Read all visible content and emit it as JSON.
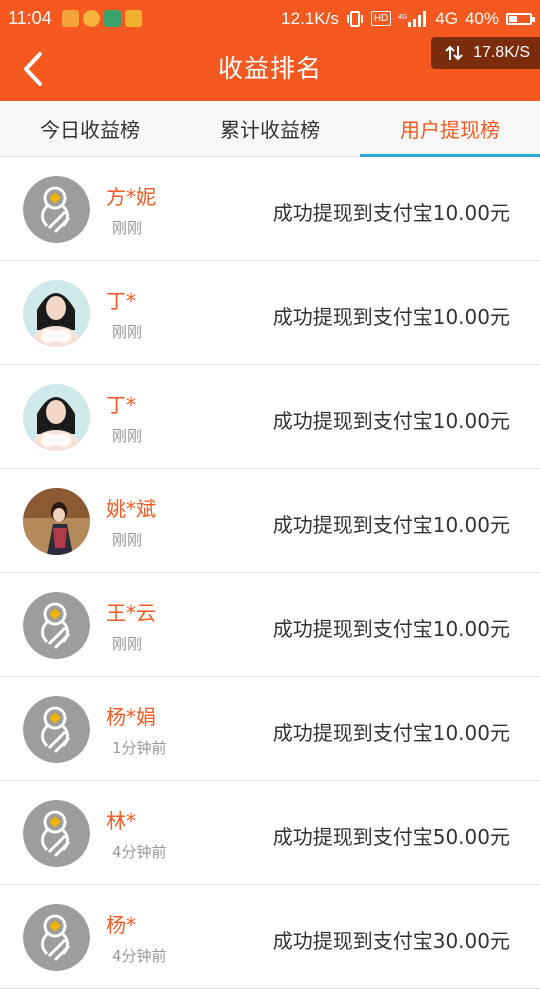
{
  "status_bar": {
    "time": "11:04",
    "net_speed": "12.1K/s",
    "hd": "HD",
    "network": "4G",
    "battery": "40%",
    "battery_level": 0.4
  },
  "header": {
    "title": "收益排名",
    "floating_speed": "17.8K/S"
  },
  "tabs": [
    {
      "label": "今日收益榜",
      "active": false
    },
    {
      "label": "累计收益榜",
      "active": false
    },
    {
      "label": "用户提现榜",
      "active": true
    }
  ],
  "records": [
    {
      "name": "方*妮",
      "time": "刚刚",
      "text": "成功提现到支付宝10.00元",
      "avatar": "default"
    },
    {
      "name": "丁*",
      "time": "刚刚",
      "text": "成功提现到支付宝10.00元",
      "avatar": "photo-girl"
    },
    {
      "name": "丁*",
      "time": "刚刚",
      "text": "成功提现到支付宝10.00元",
      "avatar": "photo-girl"
    },
    {
      "name": "姚*斌",
      "time": "刚刚",
      "text": "成功提现到支付宝10.00元",
      "avatar": "photo-kimono"
    },
    {
      "name": "王*云",
      "time": "刚刚",
      "text": "成功提现到支付宝10.00元",
      "avatar": "default"
    },
    {
      "name": "杨*娟",
      "time": "1分钟前",
      "text": "成功提现到支付宝10.00元",
      "avatar": "default"
    },
    {
      "name": "林*",
      "time": "4分钟前",
      "text": "成功提现到支付宝50.00元",
      "avatar": "default"
    },
    {
      "name": "杨*",
      "time": "4分钟前",
      "text": "成功提现到支付宝30.00元",
      "avatar": "default"
    }
  ],
  "colors": {
    "accent": "#f5591f",
    "tab_indicator": "#29a8d8"
  }
}
